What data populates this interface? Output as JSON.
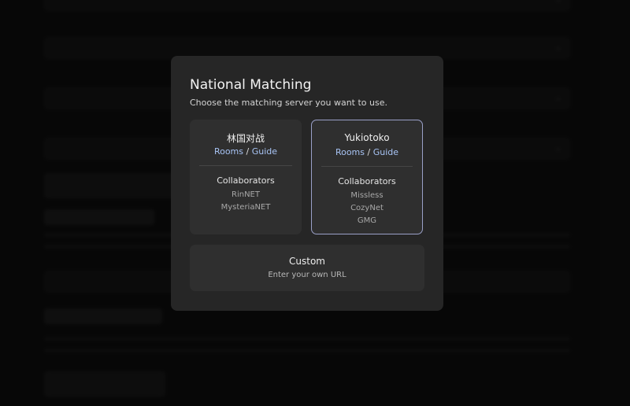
{
  "background": {
    "fields": [
      {
        "label": "",
        "value": ""
      },
      {
        "label": "",
        "value": ""
      },
      {
        "label": "",
        "value": ""
      },
      {
        "label": "",
        "value": ""
      }
    ],
    "buttons": [
      "",
      ""
    ],
    "sections": [
      "",
      ""
    ]
  },
  "modal": {
    "title": "National Matching",
    "subtitle": "Choose the matching server you want to use.",
    "servers": [
      {
        "name": "林国对战",
        "links": {
          "rooms": "Rooms",
          "separator": " / ",
          "guide": "Guide"
        },
        "collaborators_heading": "Collaborators",
        "collaborators": [
          "RinNET",
          "MysteriaNET"
        ],
        "selected": false
      },
      {
        "name": "Yukiotoko",
        "links": {
          "rooms": "Rooms",
          "separator": " / ",
          "guide": "Guide"
        },
        "collaborators_heading": "Collaborators",
        "collaborators": [
          "Missless",
          "CozyNet",
          "GMG"
        ],
        "selected": true
      }
    ],
    "custom": {
      "title": "Custom",
      "subtitle": "Enter your own URL"
    }
  },
  "colors": {
    "modal_bg": "#262626",
    "card_bg": "#2f2f2f",
    "link": "#a8c4f5",
    "selected_border": "#9aa0c8"
  }
}
